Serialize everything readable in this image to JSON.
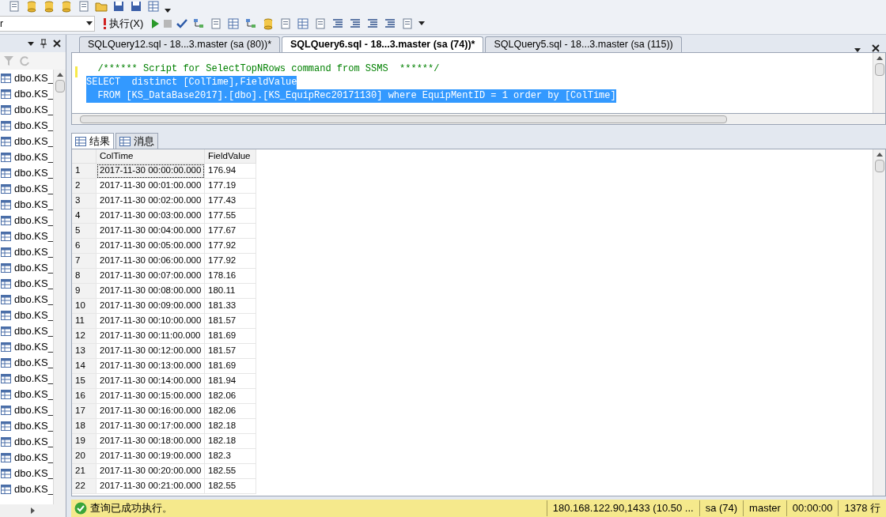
{
  "toolbar": {
    "database_combo": "r",
    "execute_label": "执行(X)"
  },
  "object_panel": {
    "items": [
      "dbo.KS_",
      "dbo.KS_",
      "dbo.KS_",
      "dbo.KS_",
      "dbo.KS_",
      "dbo.KS_",
      "dbo.KS_",
      "dbo.KS_",
      "dbo.KS_",
      "dbo.KS_",
      "dbo.KS_",
      "dbo.KS_",
      "dbo.KS_",
      "dbo.KS_",
      "dbo.KS_",
      "dbo.KS_",
      "dbo.KS_",
      "dbo.KS_",
      "dbo.KS_",
      "dbo.KS_",
      "dbo.KS_",
      "dbo.KS_",
      "dbo.KS_",
      "dbo.KS_",
      "dbo.KS_",
      "dbo.KS_",
      "dbo.KS_"
    ]
  },
  "query_tabs": [
    {
      "label": "SQLQuery12.sql - 18...3.master (sa (80))*",
      "selected": false
    },
    {
      "label": "SQLQuery6.sql - 18...3.master (sa (74))*",
      "selected": true
    },
    {
      "label": "SQLQuery5.sql - 18...3.master (sa (115))",
      "selected": false
    }
  ],
  "editor": {
    "lines": [
      {
        "kind": "comment",
        "text": "  /****** Script for SelectTopNRows command from SSMS  ******/",
        "selected": false
      },
      {
        "kind": "code",
        "text": "SELECT  distinct [ColTime],FieldValue",
        "selected": true
      },
      {
        "kind": "code",
        "text": "  FROM [KS_DataBase2017].[dbo].[KS_EquipRec20171130] where EquipMentID = 1 order by [ColTime]",
        "selected": true
      }
    ]
  },
  "result_tabs": [
    {
      "label": "结果",
      "selected": true
    },
    {
      "label": "消息",
      "selected": false
    }
  ],
  "grid": {
    "columns": [
      "",
      "ColTime",
      "FieldValue"
    ],
    "rows": [
      [
        "1",
        "2017-11-30 00:00:00.000",
        "176.94"
      ],
      [
        "2",
        "2017-11-30 00:01:00.000",
        "177.19"
      ],
      [
        "3",
        "2017-11-30 00:02:00.000",
        "177.43"
      ],
      [
        "4",
        "2017-11-30 00:03:00.000",
        "177.55"
      ],
      [
        "5",
        "2017-11-30 00:04:00.000",
        "177.67"
      ],
      [
        "6",
        "2017-11-30 00:05:00.000",
        "177.92"
      ],
      [
        "7",
        "2017-11-30 00:06:00.000",
        "177.92"
      ],
      [
        "8",
        "2017-11-30 00:07:00.000",
        "178.16"
      ],
      [
        "9",
        "2017-11-30 00:08:00.000",
        "180.11"
      ],
      [
        "10",
        "2017-11-30 00:09:00.000",
        "181.33"
      ],
      [
        "11",
        "2017-11-30 00:10:00.000",
        "181.57"
      ],
      [
        "12",
        "2017-11-30 00:11:00.000",
        "181.69"
      ],
      [
        "13",
        "2017-11-30 00:12:00.000",
        "181.57"
      ],
      [
        "14",
        "2017-11-30 00:13:00.000",
        "181.69"
      ],
      [
        "15",
        "2017-11-30 00:14:00.000",
        "181.94"
      ],
      [
        "16",
        "2017-11-30 00:15:00.000",
        "182.06"
      ],
      [
        "17",
        "2017-11-30 00:16:00.000",
        "182.06"
      ],
      [
        "18",
        "2017-11-30 00:17:00.000",
        "182.18"
      ],
      [
        "19",
        "2017-11-30 00:18:00.000",
        "182.18"
      ],
      [
        "20",
        "2017-11-30 00:19:00.000",
        "182.3"
      ],
      [
        "21",
        "2017-11-30 00:20:00.000",
        "182.55"
      ],
      [
        "22",
        "2017-11-30 00:21:00.000",
        "182.55"
      ]
    ]
  },
  "status_bar": {
    "message": "查询已成功执行。",
    "fields": [
      "180.168.122.90,1433 (10.50 ...",
      "sa (74)",
      "master",
      "00:00:00",
      "1378 行"
    ]
  }
}
